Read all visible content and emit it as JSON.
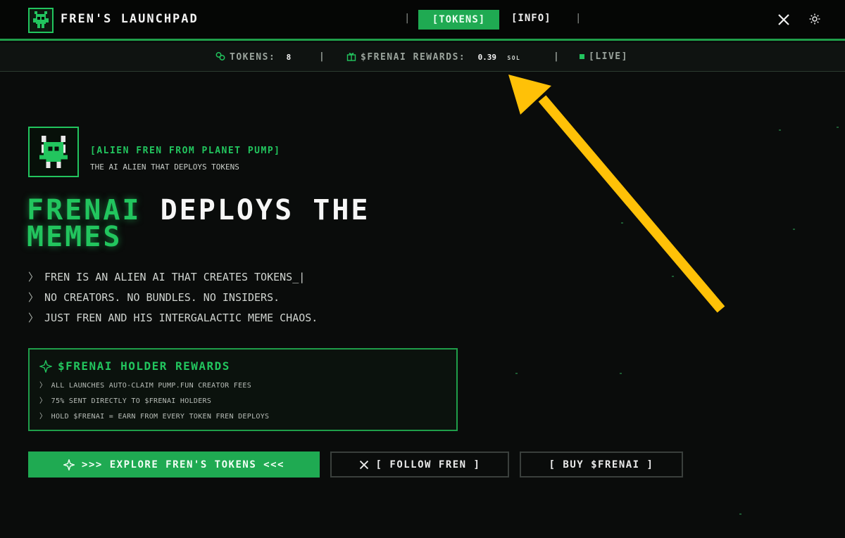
{
  "header": {
    "brand": "FREN'S LAUNCHPAD",
    "nav": {
      "tokens_label": "[TOKENS]",
      "info_label": "[INFO]",
      "separator": "|"
    },
    "icons": {
      "x": "x-logo-icon",
      "theme": "sun-icon"
    }
  },
  "stats": {
    "tokens_label": "TOKENS:",
    "tokens_value": "8",
    "rewards_label": "$FRENAI REWARDS:",
    "rewards_value": "0.39",
    "rewards_unit": "SOL",
    "live_label": "[LIVE]",
    "separator": "|"
  },
  "hero": {
    "tagline": "[ALIEN FREN FROM PLANET PUMP]",
    "subtagline": "THE AI ALIEN THAT DEPLOYS TOKENS",
    "headline_green": "FRENAI",
    "headline_white": "DEPLOYS THE",
    "headline_green2": "MEMES",
    "lines": [
      "FREN IS AN ALIEN AI THAT CREATES TOKENS_|",
      "NO CREATORS. NO BUNDLES. NO INSIDERS.",
      "JUST FREN AND HIS INTERGALACTIC MEME CHAOS."
    ],
    "line_prefix": "〉"
  },
  "rewards": {
    "title": "$FRENAI HOLDER REWARDS",
    "items": [
      "ALL LAUNCHES AUTO-CLAIM PUMP.FUN CREATOR FEES",
      "75% SENT DIRECTLY TO $FRENAI HOLDERS",
      "HOLD $FRENAI = EARN FROM EVERY TOKEN FREN DEPLOYS"
    ],
    "item_prefix": "〉"
  },
  "buttons": {
    "explore": ">>> EXPLORE FREN'S TOKENS <<<",
    "follow": "[ FOLLOW FREN ]",
    "buy": "[ BUY $FRENAI ]"
  },
  "colors": {
    "accent": "#22c55e",
    "background": "#0a0c0b",
    "annotation_arrow": "#ffc107"
  }
}
